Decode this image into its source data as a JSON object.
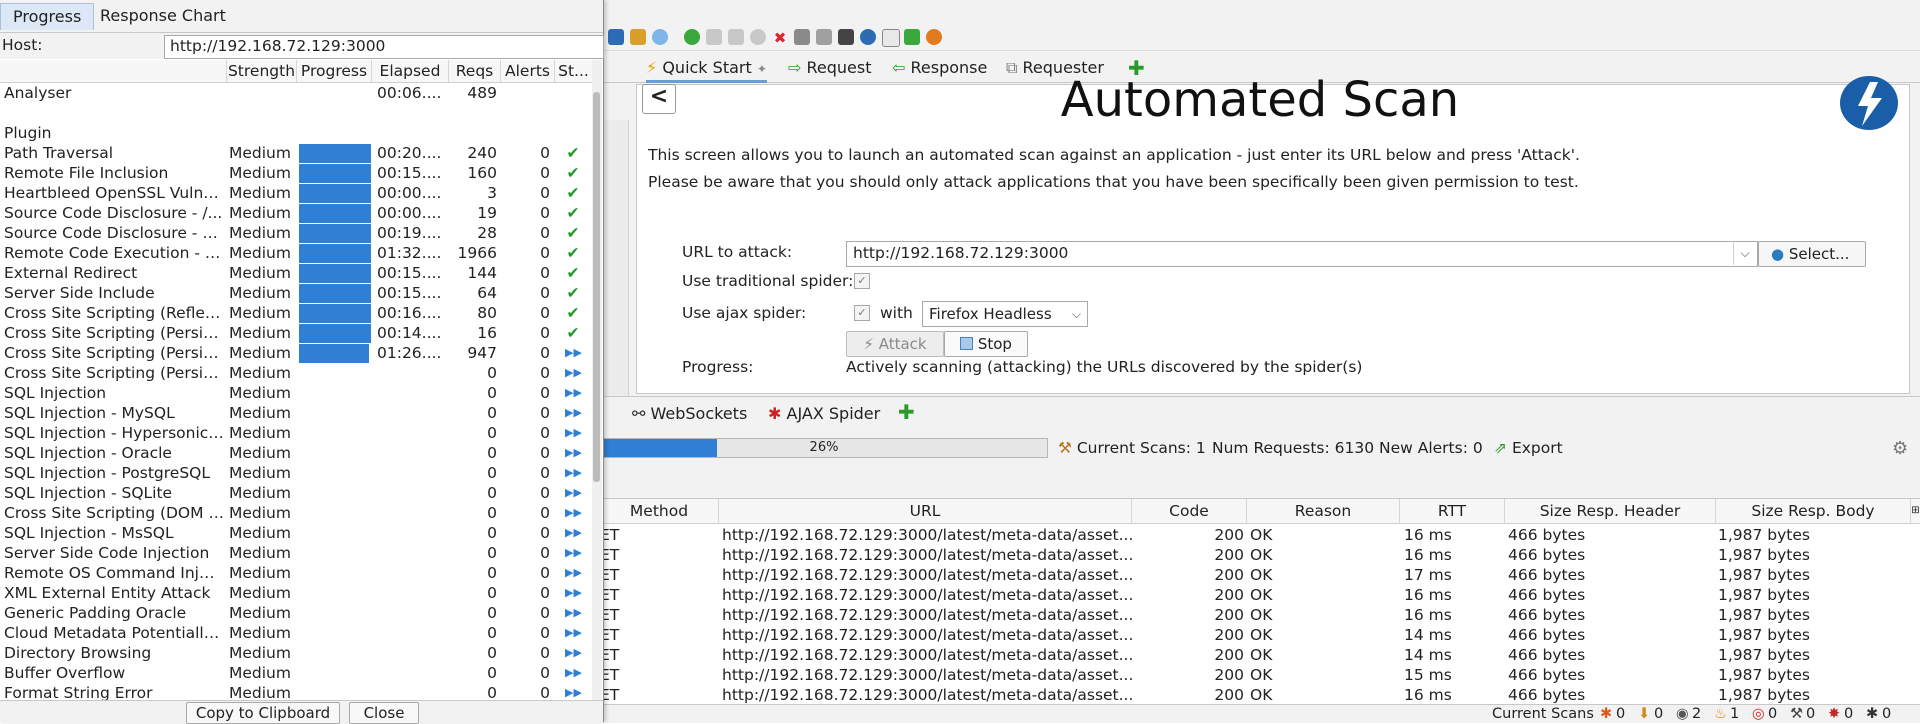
{
  "main": {
    "top_tabs": [
      {
        "label": "Quick Start",
        "icon": "lightning-icon"
      },
      {
        "label": "Request",
        "icon": "arrow-right-icon"
      },
      {
        "label": "Response",
        "icon": "arrow-left-icon"
      },
      {
        "label": "Requester",
        "icon": "requester-icon"
      }
    ],
    "scan": {
      "back_label": "<",
      "title": "Automated Scan",
      "desc1": "This screen allows you to launch an automated scan against  an application - just enter its URL below and press 'Attack'.",
      "desc2": "Please be aware that you should only attack applications that you have been specifically been given permission to test.",
      "url_label": "URL to attack:",
      "url_value": "http://192.168.72.129:3000",
      "select_label": "Select...",
      "trad_label": "Use traditional spider:",
      "ajax_label": "Use ajax spider:",
      "with_label": "with",
      "browser": "Firefox Headless",
      "attack_label": "Attack",
      "stop_label": "Stop",
      "progress_label": "Progress:",
      "progress_text": "Actively scanning (attacking) the URLs discovered by the spider(s)"
    },
    "bottom_tabs": [
      {
        "label": "WebSockets"
      },
      {
        "label": "AJAX Spider"
      }
    ],
    "progress": {
      "percent_label": "26%",
      "fraction": 0.26,
      "current_scans": "Current Scans: 1",
      "num_requests": "Num Requests: 6130",
      "new_alerts": "New Alerts: 0",
      "export_label": "Export"
    },
    "requests": {
      "headers": [
        "Method",
        "URL",
        "Code",
        "Reason",
        "RTT",
        "Size Resp. Header",
        "Size Resp. Body"
      ],
      "rows": [
        {
          "method": "ET",
          "url": "http://192.168.72.129:3000/latest/meta-data/asset...",
          "code": "200",
          "reason": "OK",
          "rtt": "16 ms",
          "hdr": "466 bytes",
          "body": "1,987 bytes"
        },
        {
          "method": "ET",
          "url": "http://192.168.72.129:3000/latest/meta-data/asset...",
          "code": "200",
          "reason": "OK",
          "rtt": "16 ms",
          "hdr": "466 bytes",
          "body": "1,987 bytes"
        },
        {
          "method": "ET",
          "url": "http://192.168.72.129:3000/latest/meta-data/asset...",
          "code": "200",
          "reason": "OK",
          "rtt": "17 ms",
          "hdr": "466 bytes",
          "body": "1,987 bytes"
        },
        {
          "method": "ET",
          "url": "http://192.168.72.129:3000/latest/meta-data/asset...",
          "code": "200",
          "reason": "OK",
          "rtt": "16 ms",
          "hdr": "466 bytes",
          "body": "1,987 bytes"
        },
        {
          "method": "ET",
          "url": "http://192.168.72.129:3000/latest/meta-data/asset...",
          "code": "200",
          "reason": "OK",
          "rtt": "16 ms",
          "hdr": "466 bytes",
          "body": "1,987 bytes"
        },
        {
          "method": "ET",
          "url": "http://192.168.72.129:3000/latest/meta-data/asset...",
          "code": "200",
          "reason": "OK",
          "rtt": "14 ms",
          "hdr": "466 bytes",
          "body": "1,987 bytes"
        },
        {
          "method": "ET",
          "url": "http://192.168.72.129:3000/latest/meta-data/asset...",
          "code": "200",
          "reason": "OK",
          "rtt": "14 ms",
          "hdr": "466 bytes",
          "body": "1,987 bytes"
        },
        {
          "method": "ET",
          "url": "http://192.168.72.129:3000/latest/meta-data/asset...",
          "code": "200",
          "reason": "OK",
          "rtt": "15 ms",
          "hdr": "466 bytes",
          "body": "1,987 bytes"
        },
        {
          "method": "ET",
          "url": "http://192.168.72.129:3000/latest/meta-data/asset...",
          "code": "200",
          "reason": "OK",
          "rtt": "16 ms",
          "hdr": "466 bytes",
          "body": "1,987 bytes"
        }
      ]
    },
    "statusbar": {
      "label": "Current Scans",
      "items": [
        {
          "icon": "spider-icon",
          "count": "0"
        },
        {
          "icon": "download-icon",
          "count": "0"
        },
        {
          "icon": "eye-icon",
          "count": "2"
        },
        {
          "icon": "flame-icon",
          "count": "1"
        },
        {
          "icon": "target-icon",
          "count": "0"
        },
        {
          "icon": "wrench-icon",
          "count": "0"
        },
        {
          "icon": "bug-icon",
          "count": "0"
        },
        {
          "icon": "ajax-spider-icon",
          "count": "0"
        }
      ]
    }
  },
  "dialog": {
    "tabs": [
      {
        "label": "Progress"
      },
      {
        "label": "Response Chart"
      }
    ],
    "host_label": "Host:",
    "host_value": "http://192.168.72.129:3000",
    "headers": [
      "Strength",
      "Progress",
      "Elapsed",
      "Reqs",
      "Alerts",
      "St..."
    ],
    "analyser": {
      "name": "Analyser",
      "elapsed": "00:06....",
      "reqs": "489"
    },
    "plugin_label": "Plugin",
    "rows": [
      {
        "name": "Path Traversal",
        "strength": "Medium",
        "progress": 1.0,
        "elapsed": "00:20....",
        "reqs": "240",
        "alerts": "0",
        "status": "done"
      },
      {
        "name": "Remote File Inclusion",
        "strength": "Medium",
        "progress": 1.0,
        "elapsed": "00:15....",
        "reqs": "160",
        "alerts": "0",
        "status": "done"
      },
      {
        "name": "Heartbleed OpenSSL Vulner...",
        "strength": "Medium",
        "progress": 1.0,
        "elapsed": "00:00....",
        "reqs": "3",
        "alerts": "0",
        "status": "done"
      },
      {
        "name": "Source Code Disclosure - /...",
        "strength": "Medium",
        "progress": 1.0,
        "elapsed": "00:00....",
        "reqs": "19",
        "alerts": "0",
        "status": "done"
      },
      {
        "name": "Source Code Disclosure - C...",
        "strength": "Medium",
        "progress": 1.0,
        "elapsed": "00:19....",
        "reqs": "28",
        "alerts": "0",
        "status": "done"
      },
      {
        "name": "Remote Code Execution - C...",
        "strength": "Medium",
        "progress": 1.0,
        "elapsed": "01:32....",
        "reqs": "1966",
        "alerts": "0",
        "status": "done"
      },
      {
        "name": "External Redirect",
        "strength": "Medium",
        "progress": 1.0,
        "elapsed": "00:15....",
        "reqs": "144",
        "alerts": "0",
        "status": "done"
      },
      {
        "name": "Server Side Include",
        "strength": "Medium",
        "progress": 1.0,
        "elapsed": "00:15....",
        "reqs": "64",
        "alerts": "0",
        "status": "done"
      },
      {
        "name": "Cross Site Scripting (Reflect...",
        "strength": "Medium",
        "progress": 1.0,
        "elapsed": "00:16....",
        "reqs": "80",
        "alerts": "0",
        "status": "done"
      },
      {
        "name": "Cross Site Scripting (Persist...",
        "strength": "Medium",
        "progress": 1.0,
        "elapsed": "00:14....",
        "reqs": "16",
        "alerts": "0",
        "status": "done"
      },
      {
        "name": "Cross Site Scripting (Persist...",
        "strength": "Medium",
        "progress": 0.97,
        "elapsed": "01:26....",
        "reqs": "947",
        "alerts": "0",
        "status": "running"
      },
      {
        "name": "Cross Site Scripting (Persist...",
        "strength": "Medium",
        "progress": 0,
        "elapsed": "",
        "reqs": "0",
        "alerts": "0",
        "status": "pending"
      },
      {
        "name": "SQL Injection",
        "strength": "Medium",
        "progress": 0,
        "elapsed": "",
        "reqs": "0",
        "alerts": "0",
        "status": "pending"
      },
      {
        "name": "SQL Injection - MySQL",
        "strength": "Medium",
        "progress": 0,
        "elapsed": "",
        "reqs": "0",
        "alerts": "0",
        "status": "pending"
      },
      {
        "name": "SQL Injection - Hypersonic S...",
        "strength": "Medium",
        "progress": 0,
        "elapsed": "",
        "reqs": "0",
        "alerts": "0",
        "status": "pending"
      },
      {
        "name": "SQL Injection - Oracle",
        "strength": "Medium",
        "progress": 0,
        "elapsed": "",
        "reqs": "0",
        "alerts": "0",
        "status": "pending"
      },
      {
        "name": "SQL Injection - PostgreSQL",
        "strength": "Medium",
        "progress": 0,
        "elapsed": "",
        "reqs": "0",
        "alerts": "0",
        "status": "pending"
      },
      {
        "name": "SQL Injection - SQLite",
        "strength": "Medium",
        "progress": 0,
        "elapsed": "",
        "reqs": "0",
        "alerts": "0",
        "status": "pending"
      },
      {
        "name": "Cross Site Scripting (DOM B...",
        "strength": "Medium",
        "progress": 0,
        "elapsed": "",
        "reqs": "0",
        "alerts": "0",
        "status": "pending"
      },
      {
        "name": "SQL Injection - MsSQL",
        "strength": "Medium",
        "progress": 0,
        "elapsed": "",
        "reqs": "0",
        "alerts": "0",
        "status": "pending"
      },
      {
        "name": "Server Side Code Injection",
        "strength": "Medium",
        "progress": 0,
        "elapsed": "",
        "reqs": "0",
        "alerts": "0",
        "status": "pending"
      },
      {
        "name": "Remote OS Command Injec...",
        "strength": "Medium",
        "progress": 0,
        "elapsed": "",
        "reqs": "0",
        "alerts": "0",
        "status": "pending"
      },
      {
        "name": "XML External Entity Attack",
        "strength": "Medium",
        "progress": 0,
        "elapsed": "",
        "reqs": "0",
        "alerts": "0",
        "status": "pending"
      },
      {
        "name": "Generic Padding Oracle",
        "strength": "Medium",
        "progress": 0,
        "elapsed": "",
        "reqs": "0",
        "alerts": "0",
        "status": "pending"
      },
      {
        "name": "Cloud Metadata Potentially ...",
        "strength": "Medium",
        "progress": 0,
        "elapsed": "",
        "reqs": "0",
        "alerts": "0",
        "status": "pending"
      },
      {
        "name": "Directory Browsing",
        "strength": "Medium",
        "progress": 0,
        "elapsed": "",
        "reqs": "0",
        "alerts": "0",
        "status": "pending"
      },
      {
        "name": "Buffer Overflow",
        "strength": "Medium",
        "progress": 0,
        "elapsed": "",
        "reqs": "0",
        "alerts": "0",
        "status": "pending"
      },
      {
        "name": "Format String Error",
        "strength": "Medium",
        "progress": 0,
        "elapsed": "",
        "reqs": "0",
        "alerts": "0",
        "status": "pending"
      }
    ],
    "copy_label": "Copy to Clipboard",
    "close_label": "Close",
    "colors": {
      "bar": "#2f7fd4",
      "ok": "#1f9a22",
      "pending": "#2f7fd4"
    }
  }
}
